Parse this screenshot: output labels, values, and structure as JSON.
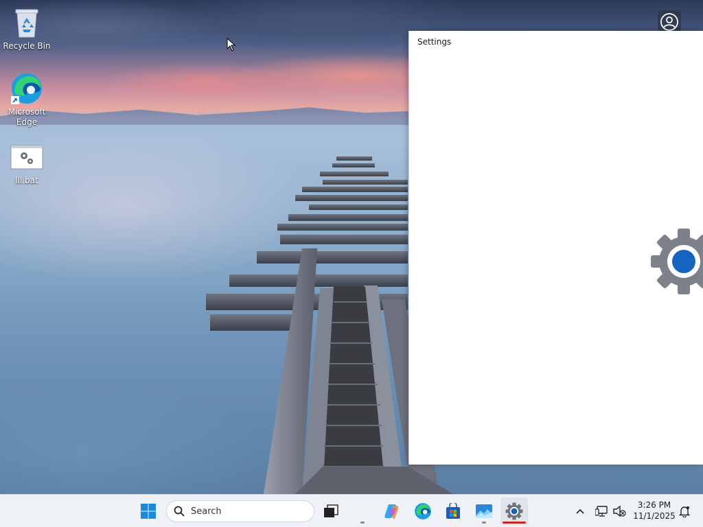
{
  "desktop": {
    "icons": [
      {
        "label": "Recycle Bin",
        "icon": "recycle-bin-icon"
      },
      {
        "label": "Microsoft Edge",
        "icon": "edge-icon"
      },
      {
        "label": "lll.bat",
        "icon": "batch-file-icon"
      }
    ]
  },
  "settings_window": {
    "title": "Settings",
    "splash_icon": "gear-icon"
  },
  "account_button": {
    "icon": "user-circle-icon"
  },
  "taskbar": {
    "start_icon": "windows-start-icon",
    "search": {
      "placeholder": "Search",
      "icon": "search-icon"
    },
    "pinned": [
      {
        "name": "Task View",
        "icon": "task-view-icon"
      },
      {
        "name": "Copilot",
        "icon": "copilot-icon"
      },
      {
        "name": "Microsoft Edge",
        "icon": "edge-icon"
      },
      {
        "name": "Microsoft Store",
        "icon": "store-icon"
      },
      {
        "name": "Photos",
        "icon": "photos-icon"
      },
      {
        "name": "Settings",
        "icon": "gear-icon",
        "active": true
      }
    ],
    "tray": {
      "overflow_icon": "chevron-up-icon",
      "network_icon": "network-icon",
      "volume_icon": "volume-muted-icon",
      "time": "3:26 PM",
      "date": "11/1/2025",
      "notifications_icon": "bell-icon"
    },
    "accent_color": "#0067c0",
    "active_indicator_color": "#c42b1c"
  }
}
